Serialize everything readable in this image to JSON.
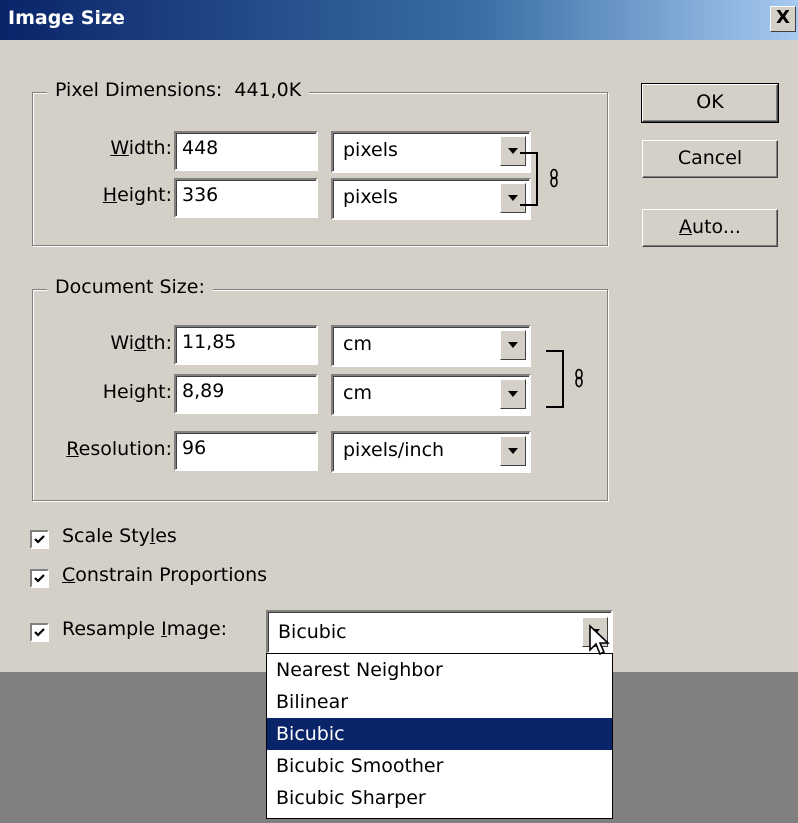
{
  "window": {
    "title": "Image Size",
    "close_glyph": "X"
  },
  "pixel_dimensions": {
    "legend": "Pixel Dimensions:",
    "size": "441,0K",
    "width": {
      "label_pre": "",
      "label_u": "W",
      "label_post": "idth:",
      "value": "448",
      "unit": "pixels"
    },
    "height": {
      "label_pre": "",
      "label_u": "H",
      "label_post": "eight:",
      "value": "336",
      "unit": "pixels"
    }
  },
  "document_size": {
    "legend": "Document Size:",
    "width": {
      "label_pre": "Wi",
      "label_u": "d",
      "label_post": "th:",
      "value": "11,85",
      "unit": "cm"
    },
    "height": {
      "label_pre": "Hei",
      "label_u": "g",
      "label_post": "ht:",
      "value": "8,89",
      "unit": "cm"
    },
    "resolution": {
      "label_pre": "",
      "label_u": "R",
      "label_post": "esolution:",
      "value": "96",
      "unit": "pixels/inch"
    }
  },
  "buttons": {
    "ok": "OK",
    "cancel": "Cancel",
    "auto_u": "A",
    "auto_post": "uto..."
  },
  "options": {
    "scale_styles": {
      "pre": "Scale Sty",
      "u": "l",
      "post": "es",
      "checked": true
    },
    "constrain": {
      "pre": "",
      "u": "C",
      "post": "onstrain Proportions",
      "checked": true
    },
    "resample": {
      "pre": "Resample ",
      "u": "I",
      "post": "mage:",
      "checked": true,
      "value": "Bicubic"
    }
  },
  "resample_menu": {
    "items": [
      "Nearest Neighbor",
      "Bilinear",
      "Bicubic",
      "Bicubic Smoother",
      "Bicubic Sharper"
    ],
    "selected": "Bicubic"
  },
  "colors": {
    "titlebar_start": "#0a246a",
    "selection": "#0a246a",
    "face": "#d4d0c8"
  }
}
